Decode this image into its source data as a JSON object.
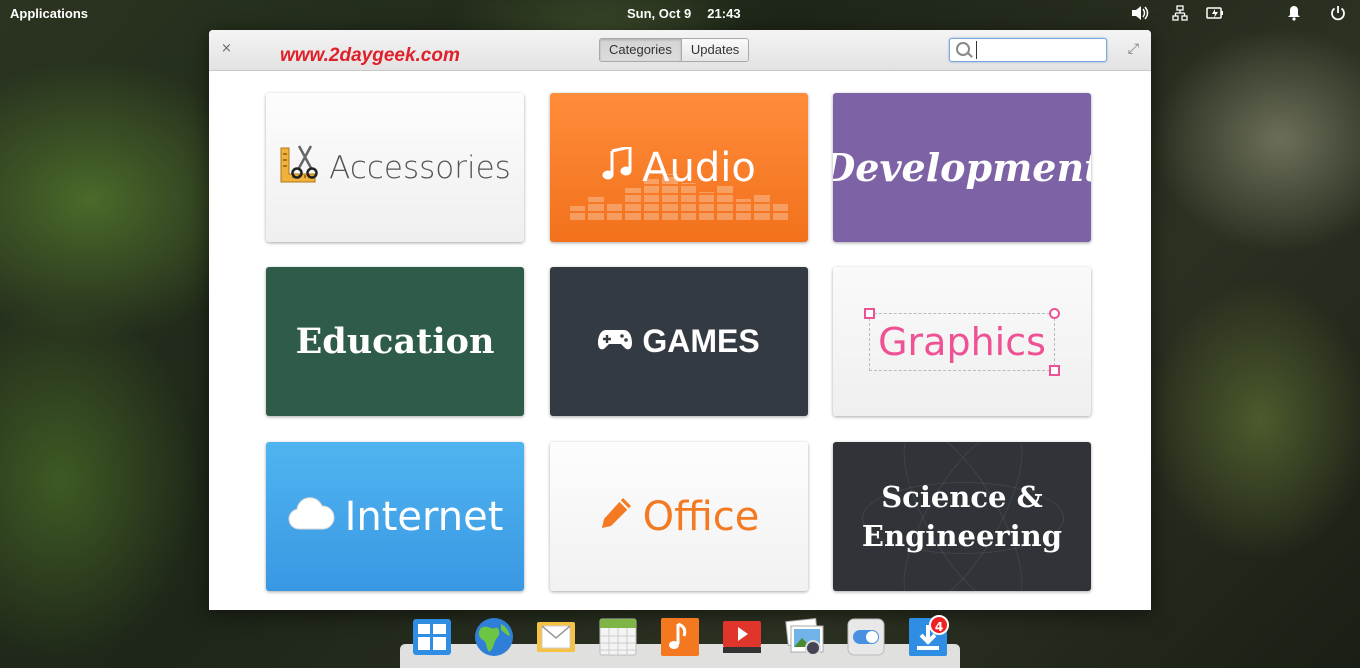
{
  "panel": {
    "applications": "Applications",
    "date": "Sun, Oct  9",
    "time": "21:43"
  },
  "window": {
    "close": "×",
    "watermark": "www.2daygeek.com",
    "tabs": [
      "Categories",
      "Updates"
    ],
    "active_tab": "Categories",
    "search": {
      "value": "",
      "placeholder": ""
    },
    "fullscreen": "⤢"
  },
  "categories": [
    {
      "label": "Accessories"
    },
    {
      "label": "Audio"
    },
    {
      "label": "Development"
    },
    {
      "label": "Education"
    },
    {
      "label": "GAMES"
    },
    {
      "label": "Graphics"
    },
    {
      "label": "Internet"
    },
    {
      "label": "Office"
    },
    {
      "label": "Science &",
      "label2": "Engineering"
    }
  ],
  "dock": {
    "items": [
      "multitasking-view-icon",
      "web-browser-icon",
      "mail-icon",
      "calendar-icon",
      "music-icon",
      "videos-icon",
      "photos-icon",
      "system-settings-icon",
      "appcenter-icon"
    ],
    "badge": "4"
  },
  "colors": {
    "audio": "#f57a25",
    "development": "#7d63a6",
    "education": "#2e5c48",
    "games": "#333a42",
    "graphics": "#ef5294",
    "internet": "#42a5ea",
    "office": "#f37a22",
    "science": "#303439"
  }
}
